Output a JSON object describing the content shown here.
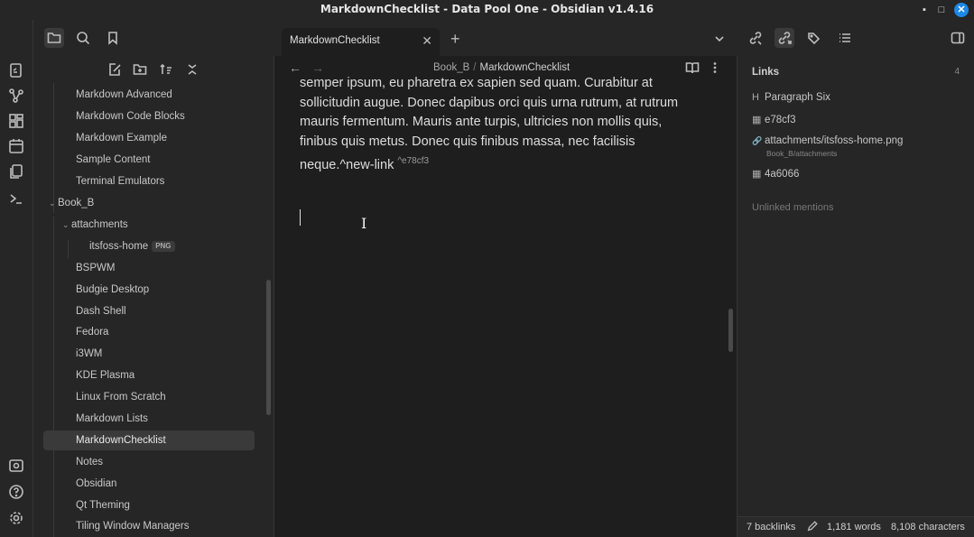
{
  "window": {
    "title": "MarkdownChecklist - Data Pool One - Obsidian v1.4.16",
    "minimize": "▪",
    "maximize": "□",
    "close": "✕"
  },
  "ribbon_icons": [
    "open-quick-switcher-icon",
    "graph-view-icon",
    "canvas-icon",
    "daily-note-icon",
    "templates-icon",
    "terminal-icon",
    "vault-switcher-icon",
    "help-icon",
    "settings-icon"
  ],
  "sidebar": {
    "items": [
      {
        "label": "Markdown Advanced",
        "level": 1
      },
      {
        "label": "Markdown Code Blocks",
        "level": 1
      },
      {
        "label": "Markdown Example",
        "level": 1
      },
      {
        "label": "Sample Content",
        "level": 1
      },
      {
        "label": "Terminal Emulators",
        "level": 1
      },
      {
        "label": "Book_B",
        "level": 0,
        "folder": true
      },
      {
        "label": "attachments",
        "level": 1,
        "folder": true
      },
      {
        "label": "itsfoss-home",
        "level": 2,
        "badge": "PNG"
      },
      {
        "label": "BSPWM",
        "level": 1
      },
      {
        "label": "Budgie Desktop",
        "level": 1
      },
      {
        "label": "Dash Shell",
        "level": 1
      },
      {
        "label": "Fedora",
        "level": 1
      },
      {
        "label": "i3WM",
        "level": 1
      },
      {
        "label": "KDE Plasma",
        "level": 1
      },
      {
        "label": "Linux From Scratch",
        "level": 1
      },
      {
        "label": "Markdown Lists",
        "level": 1
      },
      {
        "label": "MarkdownChecklist",
        "level": 1,
        "selected": true
      },
      {
        "label": "Notes",
        "level": 1
      },
      {
        "label": "Obsidian",
        "level": 1
      },
      {
        "label": "Qt Theming",
        "level": 1
      },
      {
        "label": "Tiling Window Managers",
        "level": 1
      }
    ]
  },
  "tab": {
    "label": "MarkdownChecklist",
    "close": "✕",
    "new": "+"
  },
  "editor": {
    "breadcrumb_folder": "Book_B",
    "breadcrumb_sep": "/",
    "breadcrumb_file": "MarkdownChecklist",
    "back": "←",
    "forward": "→",
    "line1": "semper ipsum, eu pharetra ex sapien sed quam. Curabitur at",
    "line2": "sollicitudin augue. Donec dapibus orci quis urna rutrum, at rutrum",
    "line3": "mauris fermentum. Mauris ante turpis, ultricies non mollis quis,",
    "line4": "finibus quis metus. Donec quis finibus massa, nec facilisis",
    "line5": "neque.^new-link",
    "block_id": "^e78cf3",
    "cursor": "I"
  },
  "links_panel": {
    "title": "Links",
    "count": "4",
    "items": [
      {
        "icon": "H",
        "label": "Paragraph Six"
      },
      {
        "icon": "▦",
        "label": "e78cf3"
      },
      {
        "icon": "🔗",
        "label": "attachments/itsfoss-home.png",
        "sub": "Book_B/attachments"
      },
      {
        "icon": "▦",
        "label": "4a6066"
      }
    ],
    "unlinked": "Unlinked mentions"
  },
  "status": {
    "backlinks": "7 backlinks",
    "words": "1,181 words",
    "characters": "8,108 characters"
  }
}
